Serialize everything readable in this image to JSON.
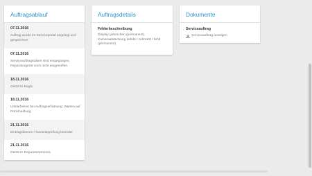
{
  "auftragsablauf": {
    "title": "Auftragsablauf",
    "entries": [
      {
        "date": "07.11.2016",
        "text": "Auftrag wurde im Serviceportal angelegt und gespeichert."
      },
      {
        "date": "07.11.2016",
        "text": "Serviceauftragsdaten sind eingegangen, Reparaturgerät noch nicht eingetroffen."
      },
      {
        "date": "18.11.2016",
        "text": "Gerät im Regln"
      },
      {
        "date": "18.11.2016",
        "text": "Unklarheiten bei Auftragserfassung: Warten auf Rückmeldung"
      },
      {
        "date": "21.11.2016",
        "text": "Eintragsbtenen / Garantieprüfung beendet"
      },
      {
        "date": "21.11.2016",
        "text": "Gerät im Reparaturprozess"
      }
    ]
  },
  "auftragsdetails": {
    "title": "Auftragsdetails",
    "label": "Fehlerbeschreibung",
    "text": "Display gebrochen (permanent), Kameraabdeckung defekt / zerkratzt / fehlt (permanent)"
  },
  "dokumente": {
    "title": "Dokumente",
    "label": "Serviceauftrag",
    "link_text": "Serviceauftrag anzeigen",
    "link_icon": "download-icon"
  },
  "colors": {
    "accent": "#2a93c9",
    "background": "#ebebeb",
    "shaded_row": "#f3f3f3"
  }
}
